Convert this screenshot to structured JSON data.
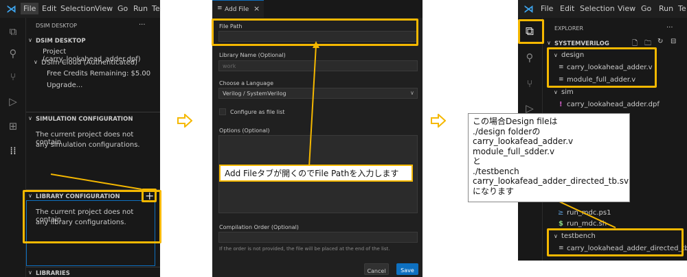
{
  "left": {
    "menu": [
      "File",
      "Edit",
      "Selection",
      "View",
      "Go",
      "Run",
      "Te"
    ],
    "sidebar_title": "DSIM DESKTOP",
    "sidebar_more": "···",
    "dsim_section": "DSIM DESKTOP",
    "project": "Project (carry_lookahead_adder.dpf)",
    "cloud": "DSim Cloud (Authenticated)",
    "credits": "Free Credits Remaining: $5.00",
    "upgrade": "Upgrade...",
    "sim_section": "SIMULATION CONFIGURATION",
    "sim_msg_1": "The current project does not contain",
    "sim_msg_2": "any simulation configurations.",
    "lib_section": "LIBRARY CONFIGURATION",
    "lib_add": "+",
    "lib_msg_1": "The current project does not contain",
    "lib_msg_2": "any library configurations.",
    "libraries_section": "LIBRARIES"
  },
  "middle": {
    "tab_label": "Add File",
    "tab_close": "×",
    "file_path_label": "File Path",
    "library_name_label": "Library Name (Optional)",
    "library_name_placeholder": "work",
    "language_label": "Choose a Language",
    "language_value": "Verilog / SystemVerilog",
    "file_list_label": "Configure as file list",
    "options_label": "Options (Optional)",
    "compilation_label": "Compilation Order (Optional)",
    "compilation_hint": "If the order is not provided, the file will be placed at the end of the list.",
    "cancel": "Cancel",
    "save": "Save",
    "callout": "Add Fileタブが開くのでFile Pathを入力します"
  },
  "right": {
    "menu": [
      "File",
      "Edit",
      "Selection",
      "View",
      "Go",
      "Run",
      "Te"
    ],
    "explorer_title": "EXPLORER",
    "explorer_more": "···",
    "workspace": "SYSTEMVERILOG",
    "design_folder": "design",
    "file1": "carry_lookahead_adder.v",
    "file2": "module_full_adder.v",
    "sim_folder": "sim",
    "dpf_file": "carry_lookahead_adder.dpf",
    "run_ps1": "run_mdc.ps1",
    "run_sh": "run_mdc.sh",
    "testbench_folder": "testbench",
    "tb_file": "carry_lookahead_adder_directed_tb.",
    "callout_lines": [
      "この場合Design fileは",
      "./design folderの",
      "carry_lookafead_adder.v",
      "module_full_sdder.v",
      "と",
      "./testbench",
      "carry_lookafead_adder_directed_tb.sv",
      "になります"
    ]
  },
  "colors": {
    "highlight": "#f5b800",
    "accent_blue": "#0e70c0",
    "vscode_blue": "#3ea6f0",
    "panel_bg": "#1e1e1e",
    "form_bg": "#202020"
  }
}
